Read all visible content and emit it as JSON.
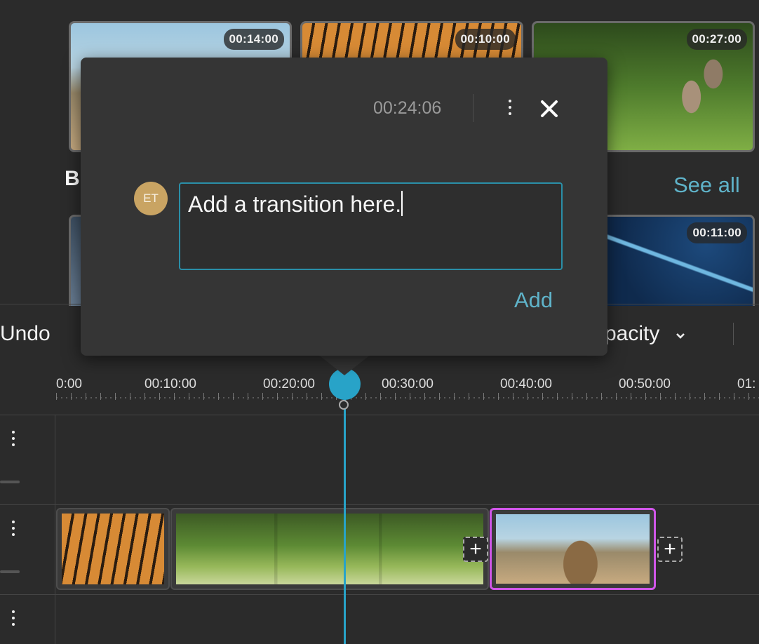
{
  "library": {
    "row1": [
      {
        "duration": "00:14:00",
        "image": "deer-antlers"
      },
      {
        "duration": "00:10:00",
        "image": "tiger"
      },
      {
        "duration": "00:27:00",
        "image": "wolves-forest"
      }
    ],
    "section_initial": "B",
    "see_all_label": "See all",
    "row2": [
      {
        "duration": "",
        "image": "person"
      },
      {
        "duration": "00:11:00",
        "image": "growth-chart"
      }
    ]
  },
  "toolbar": {
    "undo_label": "Undo",
    "opacity_label": "pacity"
  },
  "ruler": {
    "labels": [
      "0:00",
      "00:10:00",
      "00:20:00",
      "00:30:00",
      "00:40:00",
      "00:50:00",
      "01:"
    ]
  },
  "comment": {
    "timestamp": "00:24:06",
    "avatar_initials": "ET",
    "text": "Add a transition here.",
    "add_label": "Add"
  },
  "colors": {
    "accent": "#28a3c8",
    "link": "#5fb3c9",
    "selected_clip": "#d056e8",
    "avatar": "#c9a463"
  },
  "icons": {
    "more": "more-vertical-icon",
    "close": "close-icon",
    "chevron": "chevron-down-icon",
    "add_clip": "plus-icon"
  }
}
